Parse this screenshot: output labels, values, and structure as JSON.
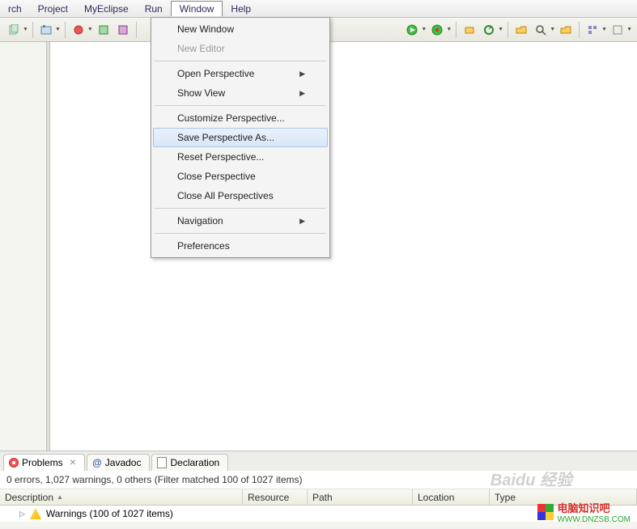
{
  "menubar": {
    "items": [
      "rch",
      "Project",
      "MyEclipse",
      "Run",
      "Window",
      "Help"
    ],
    "active_index": 4
  },
  "window_menu": {
    "groups": [
      [
        {
          "label": "New Window",
          "disabled": false,
          "has_sub": false
        },
        {
          "label": "New Editor",
          "disabled": true,
          "has_sub": false
        }
      ],
      [
        {
          "label": "Open Perspective",
          "disabled": false,
          "has_sub": true
        },
        {
          "label": "Show View",
          "disabled": false,
          "has_sub": true
        }
      ],
      [
        {
          "label": "Customize Perspective...",
          "disabled": false,
          "has_sub": false
        },
        {
          "label": "Save Perspective As...",
          "disabled": false,
          "has_sub": false,
          "highlighted": true
        },
        {
          "label": "Reset Perspective...",
          "disabled": false,
          "has_sub": false
        },
        {
          "label": "Close Perspective",
          "disabled": false,
          "has_sub": false
        },
        {
          "label": "Close All Perspectives",
          "disabled": false,
          "has_sub": false
        }
      ],
      [
        {
          "label": "Navigation",
          "disabled": false,
          "has_sub": true
        }
      ],
      [
        {
          "label": "Preferences",
          "disabled": false,
          "has_sub": false
        }
      ]
    ]
  },
  "bottom_tabs": [
    {
      "label": "Problems",
      "icon": "problems-icon",
      "active": true,
      "closable": true
    },
    {
      "label": "Javadoc",
      "icon": "javadoc-icon",
      "active": false,
      "closable": false
    },
    {
      "label": "Declaration",
      "icon": "declaration-icon",
      "active": false,
      "closable": false
    }
  ],
  "problems": {
    "status_line": "0 errors, 1,027 warnings, 0 others (Filter matched 100 of 1027 items)",
    "columns": [
      "Description",
      "Resource",
      "Path",
      "Location",
      "Type"
    ],
    "sort_col_index": 0,
    "rows": [
      {
        "description": "Warnings (100 of 1027 items)",
        "kind": "warning-group"
      }
    ]
  },
  "watermark": {
    "brand": "电脑知识吧",
    "url": "WWW.DNZSB.COM",
    "baidu": "Baidu 经验"
  }
}
